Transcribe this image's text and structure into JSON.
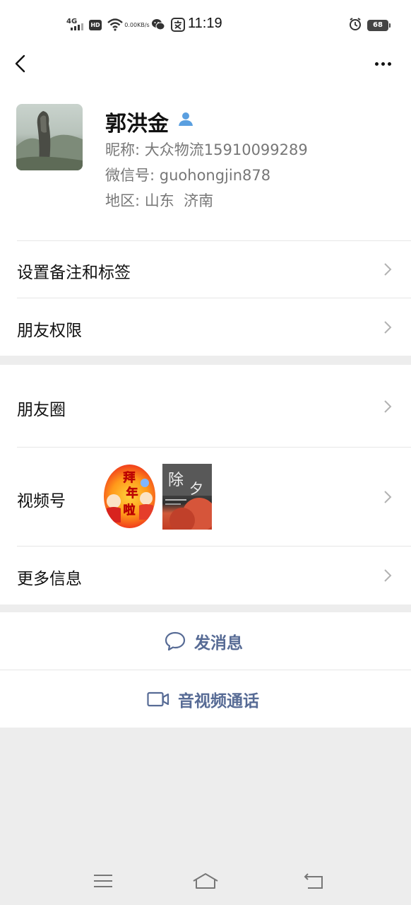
{
  "status_bar": {
    "network": "4G",
    "hd": "HD",
    "speed_value": "0.00",
    "speed_unit": "KB/s",
    "time": "11:19",
    "battery": "68"
  },
  "profile": {
    "name": "郭洪金",
    "nickname_label": "昵称:",
    "nickname": "大众物流15910099289",
    "wechat_id_label": "微信号:",
    "wechat_id": "guohongjin878",
    "region_label": "地区:",
    "region": "山东  济南"
  },
  "settings": {
    "remarks_tags": "设置备注和标签",
    "friend_permissions": "朋友权限"
  },
  "content": {
    "moments": "朋友圈",
    "channels": "视频号",
    "channel_thumb1_text": "拜年啦",
    "channel_thumb2_text": "除夕",
    "more_info": "更多信息"
  },
  "actions": {
    "send_message": "发消息",
    "video_call": "音视频通话"
  },
  "colors": {
    "link": "#576b95",
    "verify": "#5a9fe0",
    "background": "#ededed"
  }
}
